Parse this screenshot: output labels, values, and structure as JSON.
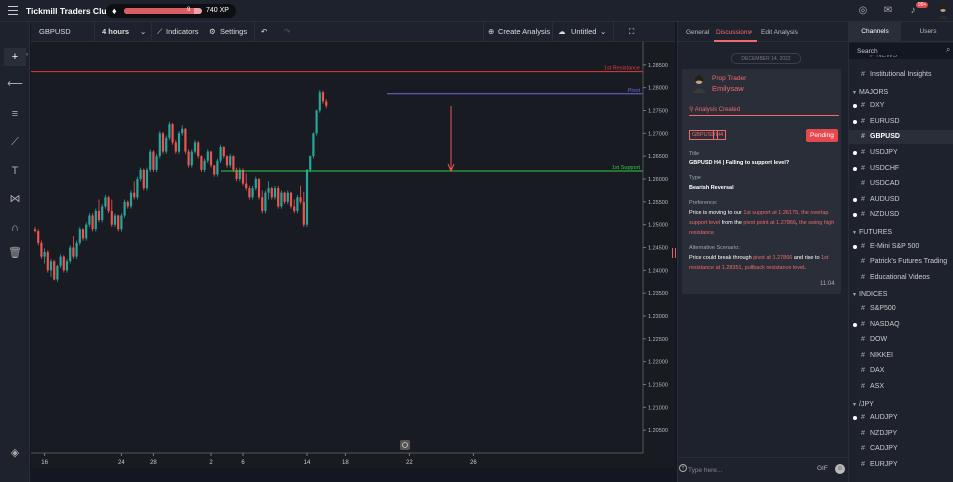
{
  "app": {
    "brand": "Tickmill Traders Club",
    "xp_text": "740 XP",
    "xp_progress": 0.9,
    "xp_level": "9",
    "notif_badge": "99+",
    "accent": "#ef6b6b"
  },
  "toolbar": {
    "symbol": "GBPUSD",
    "interval": "4 hours",
    "indicators": "Indicators",
    "settings": "Settings",
    "create_analysis": "Create Analysis",
    "layout_name": "Untitled"
  },
  "chart_data": {
    "type": "candlestick",
    "ylim": [
      1.2,
      1.29
    ],
    "ymin_tick": 1.205,
    "ytick_step": 0.005,
    "ytick_labels": [
      "1.28500",
      "1.28000",
      "1.27500",
      "1.27000",
      "1.26500",
      "1.26000",
      "1.25500",
      "1.25000",
      "1.24500",
      "1.24000",
      "1.23500",
      "1.23000",
      "1.22500",
      "1.22000",
      "1.21500",
      "1.21000",
      "1.20500"
    ],
    "xtick_labels": [
      "16",
      "24",
      "28",
      "2",
      "6",
      "14",
      "18",
      "22",
      "26"
    ],
    "xtick_index": [
      3,
      27,
      37,
      55,
      65,
      85,
      97,
      117,
      137
    ],
    "levels": [
      {
        "name": "1st Resistance",
        "value": 1.28351,
        "label": "1.28351",
        "color": "#e23d3d"
      },
      {
        "name": "Pivot",
        "value": 1.27866,
        "label": "1.2786",
        "color": "#6a6ae0"
      },
      {
        "name": "1st Support",
        "value": 1.26175,
        "label": "1.26175",
        "color": "#2ecc40"
      }
    ],
    "last_price": {
      "value": 1.27602,
      "label": "1.27602"
    },
    "current_label": "1.27500",
    "candles": [
      [
        1.249,
        1.2495,
        1.2483,
        1.2486
      ],
      [
        1.2486,
        1.249,
        1.2455,
        1.246
      ],
      [
        1.246,
        1.2465,
        1.2425,
        1.243
      ],
      [
        1.243,
        1.2448,
        1.2415,
        1.244
      ],
      [
        1.244,
        1.2444,
        1.2395,
        1.24
      ],
      [
        1.24,
        1.2425,
        1.2385,
        1.242
      ],
      [
        1.242,
        1.2423,
        1.2378,
        1.238
      ],
      [
        1.238,
        1.2412,
        1.2375,
        1.241
      ],
      [
        1.241,
        1.2435,
        1.2405,
        1.243
      ],
      [
        1.243,
        1.2433,
        1.2395,
        1.24
      ],
      [
        1.24,
        1.2425,
        1.2395,
        1.242
      ],
      [
        1.242,
        1.2455,
        1.2415,
        1.245
      ],
      [
        1.245,
        1.2475,
        1.2425,
        1.243
      ],
      [
        1.243,
        1.2465,
        1.2425,
        1.246
      ],
      [
        1.246,
        1.2495,
        1.2455,
        1.249
      ],
      [
        1.249,
        1.2492,
        1.2465,
        1.247
      ],
      [
        1.247,
        1.2505,
        1.2465,
        1.25
      ],
      [
        1.25,
        1.2525,
        1.2495,
        1.252
      ],
      [
        1.252,
        1.2525,
        1.2485,
        1.249
      ],
      [
        1.249,
        1.2535,
        1.2485,
        1.253
      ],
      [
        1.253,
        1.2555,
        1.2505,
        1.251
      ],
      [
        1.251,
        1.2545,
        1.2505,
        1.254
      ],
      [
        1.254,
        1.2565,
        1.2535,
        1.256
      ],
      [
        1.256,
        1.2563,
        1.2525,
        1.253
      ],
      [
        1.253,
        1.2555,
        1.2495,
        1.25
      ],
      [
        1.25,
        1.2525,
        1.2495,
        1.252
      ],
      [
        1.252,
        1.2522,
        1.2485,
        1.249
      ],
      [
        1.249,
        1.2525,
        1.2485,
        1.252
      ],
      [
        1.252,
        1.2555,
        1.2515,
        1.255
      ],
      [
        1.255,
        1.2553,
        1.2535,
        1.254
      ],
      [
        1.254,
        1.2575,
        1.2535,
        1.257
      ],
      [
        1.257,
        1.2595,
        1.2555,
        1.256
      ],
      [
        1.256,
        1.2605,
        1.2555,
        1.26
      ],
      [
        1.26,
        1.2625,
        1.2595,
        1.262
      ],
      [
        1.262,
        1.2623,
        1.2575,
        1.258
      ],
      [
        1.258,
        1.2625,
        1.2575,
        1.262
      ],
      [
        1.262,
        1.2665,
        1.2615,
        1.266
      ],
      [
        1.266,
        1.2663,
        1.2615,
        1.262
      ],
      [
        1.262,
        1.2655,
        1.2615,
        1.265
      ],
      [
        1.265,
        1.2705,
        1.2645,
        1.27
      ],
      [
        1.27,
        1.2703,
        1.2655,
        1.266
      ],
      [
        1.266,
        1.2695,
        1.2655,
        1.269
      ],
      [
        1.269,
        1.2725,
        1.2685,
        1.272
      ],
      [
        1.272,
        1.2723,
        1.2675,
        1.268
      ],
      [
        1.268,
        1.2685,
        1.2655,
        1.266
      ],
      [
        1.266,
        1.2705,
        1.2655,
        1.27
      ],
      [
        1.27,
        1.2718,
        1.2695,
        1.271
      ],
      [
        1.271,
        1.2712,
        1.2655,
        1.266
      ],
      [
        1.266,
        1.2665,
        1.2625,
        1.263
      ],
      [
        1.263,
        1.2665,
        1.2625,
        1.266
      ],
      [
        1.266,
        1.2685,
        1.2655,
        1.268
      ],
      [
        1.268,
        1.2683,
        1.2645,
        1.265
      ],
      [
        1.265,
        1.2652,
        1.2615,
        1.262
      ],
      [
        1.262,
        1.2645,
        1.2615,
        1.264
      ],
      [
        1.264,
        1.2665,
        1.2635,
        1.266
      ],
      [
        1.266,
        1.2662,
        1.2625,
        1.263
      ],
      [
        1.263,
        1.2625,
        1.2605,
        1.261
      ],
      [
        1.261,
        1.2645,
        1.2605,
        1.264
      ],
      [
        1.264,
        1.2675,
        1.2635,
        1.267
      ],
      [
        1.267,
        1.2672,
        1.2645,
        1.265
      ],
      [
        1.265,
        1.2652,
        1.2625,
        1.263
      ],
      [
        1.263,
        1.2655,
        1.2625,
        1.265
      ],
      [
        1.265,
        1.2652,
        1.2615,
        1.262
      ],
      [
        1.262,
        1.2625,
        1.2595,
        1.26
      ],
      [
        1.26,
        1.2625,
        1.2595,
        1.262
      ],
      [
        1.262,
        1.2623,
        1.2585,
        1.259
      ],
      [
        1.259,
        1.2612,
        1.2575,
        1.258
      ],
      [
        1.258,
        1.2585,
        1.2555,
        1.256
      ],
      [
        1.256,
        1.2585,
        1.2555,
        1.258
      ],
      [
        1.258,
        1.2605,
        1.2575,
        1.26
      ],
      [
        1.26,
        1.2602,
        1.2555,
        1.256
      ],
      [
        1.256,
        1.2575,
        1.2525,
        1.253
      ],
      [
        1.253,
        1.2575,
        1.2525,
        1.257
      ],
      [
        1.257,
        1.2595,
        1.2555,
        1.258
      ],
      [
        1.258,
        1.2583,
        1.2555,
        1.256
      ],
      [
        1.256,
        1.2585,
        1.2555,
        1.258
      ],
      [
        1.258,
        1.2585,
        1.2535,
        1.254
      ],
      [
        1.254,
        1.2575,
        1.2535,
        1.257
      ],
      [
        1.257,
        1.2572,
        1.2545,
        1.255
      ],
      [
        1.255,
        1.2575,
        1.2545,
        1.257
      ],
      [
        1.257,
        1.2572,
        1.2535,
        1.254
      ],
      [
        1.254,
        1.2555,
        1.2525,
        1.253
      ],
      [
        1.253,
        1.2565,
        1.2525,
        1.256
      ],
      [
        1.256,
        1.2585,
        1.2545,
        1.255
      ],
      [
        1.255,
        1.2572,
        1.2495,
        1.25
      ],
      [
        1.25,
        1.2622,
        1.2495,
        1.262
      ],
      [
        1.262,
        1.2652,
        1.2615,
        1.265
      ],
      [
        1.265,
        1.2702,
        1.2645,
        1.27
      ],
      [
        1.27,
        1.2752,
        1.2695,
        1.275
      ],
      [
        1.275,
        1.2795,
        1.2745,
        1.279
      ],
      [
        1.279,
        1.2793,
        1.2765,
        1.277
      ],
      [
        1.277,
        1.2775,
        1.2755,
        1.276
      ]
    ]
  },
  "discussion": {
    "tabs": [
      "General",
      "Discussions",
      "Edit Analysis"
    ],
    "active_tab": 1,
    "close_glyph": "×",
    "date": "DECEMBER 14, 2022",
    "author_role": "Prop Trader",
    "author_name": "Emilysaw",
    "created": "Analysis Created",
    "tags": [
      "GBPUSD",
      "H4"
    ],
    "status": "Pending",
    "title_label": "Title",
    "title": "GBPUSD H4 | Falling to support level?",
    "type_label": "Type",
    "type": "Bearish Reversal",
    "pref_label": "Preference:",
    "pref_parts": [
      "Price is moving to our ",
      "1st support at 1.26175, the overlap support level",
      " from the ",
      "pivot point at 1.27866",
      ", ",
      "the swing high resistance"
    ],
    "alt_label": "Alternative Scenario:",
    "alt_parts": [
      "Price could break through ",
      "pivot at 1.27866",
      " and rise to ",
      "1st resistance at 1.28351, pullback resistance level",
      "."
    ],
    "time": "11:04",
    "input_placeholder": "Type here...",
    "gif": "GIF"
  },
  "channels": {
    "tabs": [
      "Channels",
      "Users"
    ],
    "active_tab": 0,
    "search_placeholder": "Search",
    "partial_top": "F NEWS",
    "items": [
      {
        "kind": "channel",
        "name": "Institutional Insights",
        "bullet": false,
        "active": false
      },
      {
        "kind": "group",
        "name": "MAJORS"
      },
      {
        "kind": "channel",
        "name": "DXY",
        "bullet": true,
        "active": false
      },
      {
        "kind": "channel",
        "name": "EURUSD",
        "bullet": true,
        "active": false
      },
      {
        "kind": "channel",
        "name": "GBPUSD",
        "bullet": false,
        "active": true
      },
      {
        "kind": "channel",
        "name": "USDJPY",
        "bullet": true,
        "active": false
      },
      {
        "kind": "channel",
        "name": "USDCHF",
        "bullet": true,
        "active": false
      },
      {
        "kind": "channel",
        "name": "USDCAD",
        "bullet": false,
        "active": false
      },
      {
        "kind": "channel",
        "name": "AUDUSD",
        "bullet": true,
        "active": false
      },
      {
        "kind": "channel",
        "name": "NZDUSD",
        "bullet": true,
        "active": false
      },
      {
        "kind": "group",
        "name": "FUTURES"
      },
      {
        "kind": "channel",
        "name": "E-Mini S&P 500",
        "bullet": true,
        "active": false
      },
      {
        "kind": "channel",
        "name": "Patrick's Futures Trading",
        "bullet": false,
        "active": false
      },
      {
        "kind": "channel",
        "name": "Educational Videos",
        "bullet": false,
        "active": false
      },
      {
        "kind": "group",
        "name": "INDICES"
      },
      {
        "kind": "channel",
        "name": "S&P500",
        "bullet": false,
        "active": false
      },
      {
        "kind": "channel",
        "name": "NASDAQ",
        "bullet": true,
        "active": false
      },
      {
        "kind": "channel",
        "name": "DOW",
        "bullet": false,
        "active": false
      },
      {
        "kind": "channel",
        "name": "NIKKEI",
        "bullet": false,
        "active": false
      },
      {
        "kind": "channel",
        "name": "DAX",
        "bullet": false,
        "active": false
      },
      {
        "kind": "channel",
        "name": "ASX",
        "bullet": false,
        "active": false
      },
      {
        "kind": "group",
        "name": "/JPY"
      },
      {
        "kind": "channel",
        "name": "AUDJPY",
        "bullet": true,
        "active": false
      },
      {
        "kind": "channel",
        "name": "NZDJPY",
        "bullet": false,
        "active": false
      },
      {
        "kind": "channel",
        "name": "CADJPY",
        "bullet": false,
        "active": false
      },
      {
        "kind": "channel",
        "name": "EURJPY",
        "bullet": false,
        "active": false
      }
    ]
  },
  "colors": {
    "up": "#26a69a",
    "down": "#ef5350",
    "bg": "#191b22"
  }
}
